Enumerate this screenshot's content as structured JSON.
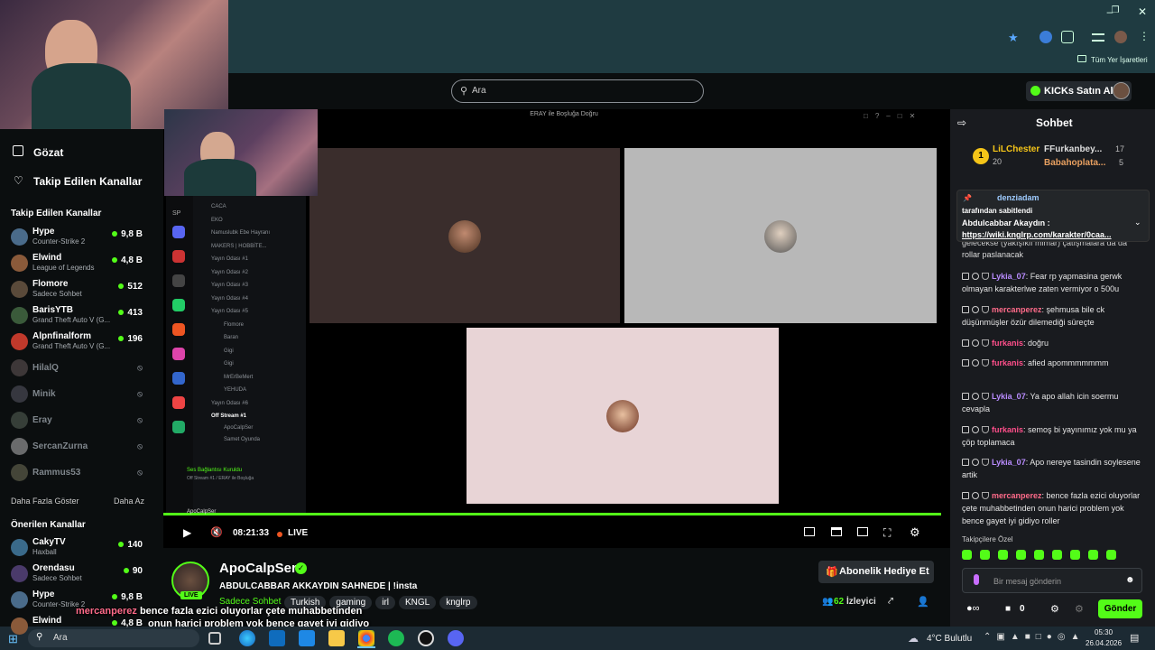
{
  "browser": {
    "bookmarks_label": "Tüm Yer İşaretleri"
  },
  "header": {
    "search_placeholder": "Ara",
    "kicks_button": "KICKs Satın Al"
  },
  "sidebar": {
    "nav": [
      {
        "label": "Gözat",
        "icon": "browse-icon"
      },
      {
        "label": "Takip Edilen Kanallar",
        "icon": "heart-icon"
      }
    ],
    "followed_title": "Takip Edilen Kanallar",
    "followed": [
      {
        "name": "Hype",
        "category": "Counter-Strike 2",
        "viewers": "9,8 B",
        "live": true,
        "color": "#4a6b8a"
      },
      {
        "name": "Elwind",
        "category": "League of Legends",
        "viewers": "4,8 B",
        "live": true,
        "color": "#8a5a3a"
      },
      {
        "name": "Flomore",
        "category": "Sadece Sohbet",
        "viewers": "512",
        "live": true,
        "color": "#5a4a3a"
      },
      {
        "name": "BarisYTB",
        "category": "Grand Theft Auto V (G...",
        "viewers": "413",
        "live": true,
        "color": "#3a5a3a"
      },
      {
        "name": "Alpnfinalform",
        "category": "Grand Theft Auto V (G...",
        "viewers": "196",
        "live": true,
        "color": "#c0392b"
      },
      {
        "name": "HilalQ",
        "live": false,
        "color": "#7a6a6a"
      },
      {
        "name": "Minik",
        "live": false,
        "color": "#6a6a7a"
      },
      {
        "name": "Eray",
        "live": false,
        "color": "#6a7a6a"
      },
      {
        "name": "SercanZurna",
        "live": false,
        "color": "#dddddd"
      },
      {
        "name": "Rammus53",
        "live": false,
        "color": "#8a8a6a"
      }
    ],
    "show_more": "Daha Fazla Göster",
    "show_less": "Daha Az",
    "recommended_title": "Önerilen Kanallar",
    "recommended": [
      {
        "name": "CakyTV",
        "category": "Haxball",
        "viewers": "140",
        "color": "#3a6a8a"
      },
      {
        "name": "Orendasu",
        "category": "Sadece Sohbet",
        "viewers": "90",
        "color": "#4a3a6a"
      },
      {
        "name": "Hype",
        "category": "Counter-Strike 2",
        "viewers": "9,8 B",
        "color": "#4a6b8a"
      },
      {
        "name": "Elwind",
        "category": "",
        "viewers": "4,8 B",
        "color": "#8a5a3a"
      }
    ]
  },
  "player": {
    "window_title": "ERAY ile Boşluğa Doğru",
    "time": "08:21:33",
    "live_label": "LIVE",
    "discord": {
      "server_short": "SP",
      "channels": [
        "CACA",
        "EKO",
        "Namuslubk Ebe Hayranı",
        "MAKERS | HOBBİTE...",
        "Yayın Odası #1",
        "Yayın Odası #2",
        "Yayın Odası #3",
        "Yayın Odası #4",
        "Yayın Odası #5",
        "Flomore",
        "Baran",
        "Gigi",
        "Gigi",
        "MrErBeMert",
        "YEHUDA",
        "Yayın Odası #6",
        "Off Stream #1",
        "ApoCalpSer",
        "Samet Oyunda"
      ],
      "connection": "Ses Bağlantısı Kuruldu",
      "connection_sub": "Off Stream #1 / ERAY ile Boşluğa",
      "user": "ApoCalpSer"
    }
  },
  "stream": {
    "streamer": "ApoCalpSer",
    "live_badge": "LIVE",
    "title": "ABDULCABBAR AKKAYDIN SAHNEDE | !insta",
    "category": "Sadece Sohbet",
    "tags": [
      "Turkish",
      "gaming",
      "irl",
      "KNGL",
      "knglrp"
    ],
    "gift_button": "Abonelik Hediye Et",
    "viewers": "62",
    "viewers_label": "İzleyici"
  },
  "overlay": {
    "user": "mercanperez",
    "line1": "bence fazla ezici oluyorlar çete muhabbetinden",
    "line2": "onun harici problem yok bence gayet iyi gidiyo",
    "line3": "roller"
  },
  "chat": {
    "title": "Sohbet",
    "leaderboard": [
      {
        "name": "LiLChester",
        "value": "20"
      },
      {
        "name": "FFurkanbey...",
        "value": "17"
      },
      {
        "name": "Babahoplata...",
        "value": "5"
      }
    ],
    "pinned": {
      "by": "denziadam",
      "by_label": "tarafından sabitlendi",
      "author": "Abdulcabbar Akaydın :",
      "link": "https://wiki.knglrp.com/karakter/0caa..."
    },
    "partial_top": "gelecekse (yakışıklı mimar) çatışmalara da da",
    "partial_top2": "rollar paslanacak",
    "messages": [
      {
        "user": "Lykia_07",
        "color": "#b98cff",
        "text": "Fear rp yapmasina gerwk olmayan karakterlwe zaten vermiyor o 500u"
      },
      {
        "user": "mercanperez",
        "color": "#ff6b8a",
        "text": "şehmusa bile ck düşünmüşler özür dilemediği süreçte"
      },
      {
        "user": "furkanis",
        "color": "#ff4f8b",
        "text": "doğru"
      },
      {
        "user": "furkanis",
        "color": "#ff4f8b",
        "text": "afied apommmmmmm"
      },
      {
        "user": "Lykia_07",
        "color": "#b98cff",
        "text": "Ya apo allah icin soermu cevapla"
      },
      {
        "user": "furkanis",
        "color": "#ff4f8b",
        "text": "semoş bi yayınımız yok mu ya çöp toplamaca"
      },
      {
        "user": "Lykia_07",
        "color": "#b98cff",
        "text": "Apo nereye tasindin soylesene artik"
      },
      {
        "user": "mercanperez",
        "color": "#ff6b8a",
        "text": "bence fazla ezici oluyorlar çete muhabbetinden onun harici problem yok bence gayet iyi gidiyo roller"
      }
    ],
    "emote_section": "Takipçilere Özel",
    "input_placeholder": "Bir mesaj gönderin",
    "send_button": "Gönder",
    "points": "0"
  },
  "taskbar": {
    "search": "Ara",
    "weather": "4°C  Bulutlu",
    "time": "05:30",
    "date": "26.04.2026"
  },
  "colors": {
    "accent": "#53fc18",
    "bg": "#0b0e0f",
    "chat_bg": "#191b1f"
  }
}
